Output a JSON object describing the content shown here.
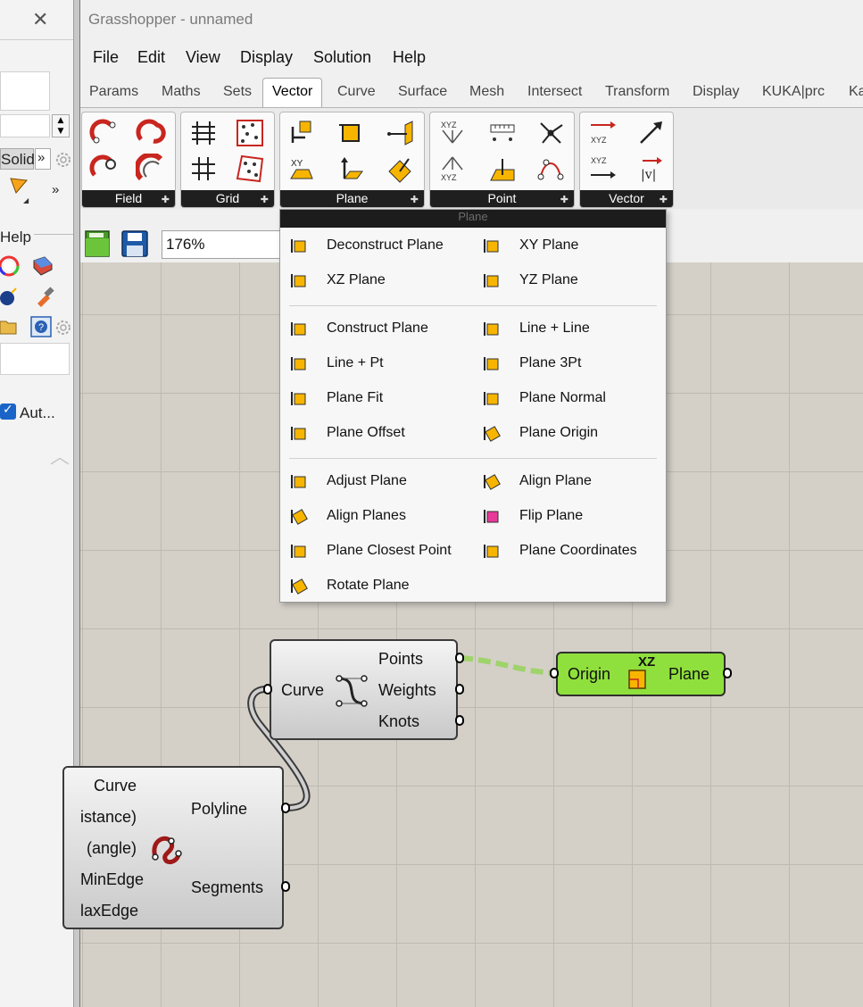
{
  "app": {
    "title": "Grasshopper - unnamed"
  },
  "left_panel": {
    "solid_label": "Solid",
    "more_label": "»",
    "help_label": "Help",
    "auto_label": "Aut..."
  },
  "menu": [
    "File",
    "Edit",
    "View",
    "Display",
    "Solution",
    "Help"
  ],
  "tabs": [
    "Params",
    "Maths",
    "Sets",
    "Vector",
    "Curve",
    "Surface",
    "Mesh",
    "Intersect",
    "Transform",
    "Display",
    "KUKA|prc",
    "Ka"
  ],
  "active_tab": "Vector",
  "ribbon_groups": [
    "Field",
    "Grid",
    "Plane",
    "Point",
    "Vector"
  ],
  "zoom": "176%",
  "dropdown": {
    "header": "Plane",
    "sections": [
      [
        {
          "label": "Deconstruct Plane",
          "icon": "deconstruct-plane-icon"
        },
        {
          "label": "XY Plane",
          "icon": "xy-plane-icon"
        },
        {
          "label": "XZ Plane",
          "icon": "xz-plane-icon"
        },
        {
          "label": "YZ Plane",
          "icon": "yz-plane-icon"
        }
      ],
      [
        {
          "label": "Construct Plane",
          "icon": "construct-plane-icon"
        },
        {
          "label": "Line + Line",
          "icon": "line-line-icon"
        },
        {
          "label": "Line + Pt",
          "icon": "line-pt-icon"
        },
        {
          "label": "Plane 3Pt",
          "icon": "plane-3pt-icon"
        },
        {
          "label": "Plane Fit",
          "icon": "plane-fit-icon"
        },
        {
          "label": "Plane Normal",
          "icon": "plane-normal-icon"
        },
        {
          "label": "Plane Offset",
          "icon": "plane-offset-icon"
        },
        {
          "label": "Plane Origin",
          "icon": "plane-origin-icon"
        }
      ],
      [
        {
          "label": "Adjust Plane",
          "icon": "adjust-plane-icon"
        },
        {
          "label": "Align Plane",
          "icon": "align-plane-icon"
        },
        {
          "label": "Align Planes",
          "icon": "align-planes-icon"
        },
        {
          "label": "Flip Plane",
          "icon": "flip-plane-icon"
        },
        {
          "label": "Plane Closest Point",
          "icon": "plane-closest-point-icon"
        },
        {
          "label": "Plane Coordinates",
          "icon": "plane-coordinates-icon"
        },
        {
          "label": "Rotate Plane",
          "icon": "rotate-plane-icon"
        }
      ]
    ]
  },
  "components": {
    "control_points": {
      "input": "Curve",
      "outputs": [
        "Points",
        "Weights",
        "Knots"
      ]
    },
    "xz_plane": {
      "input": "Origin",
      "badge": "XZ",
      "output": "Plane"
    },
    "polyline": {
      "inputs": [
        "Curve",
        "istance)",
        "(angle)",
        "MinEdge",
        "laxEdge"
      ],
      "outputs": [
        "Polyline",
        "Segments"
      ]
    }
  },
  "colors": {
    "component_green": "#8fe03c",
    "canvas": "#d4d0c8",
    "ribbon_label_bg": "#1f1f1f",
    "wire": "#3a3a3a",
    "selected_wire": "#9fd36b"
  }
}
